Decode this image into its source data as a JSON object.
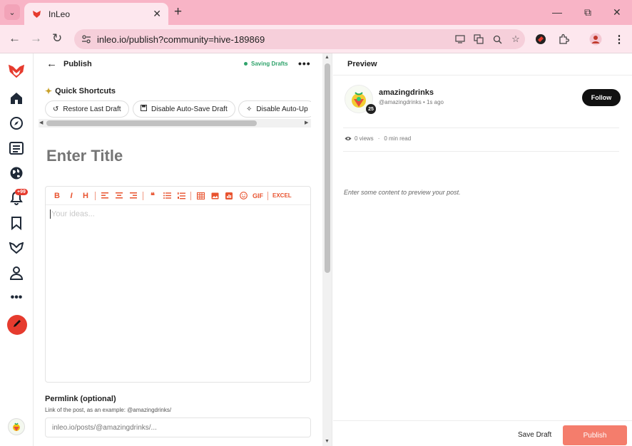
{
  "browser": {
    "tab_title": "InLeo",
    "url": "inleo.io/publish?community=hive-189869"
  },
  "editor": {
    "header_title": "Publish",
    "saving_status": "Saving Drafts",
    "quick_shortcuts_title": "Quick Shortcuts",
    "shortcuts": [
      {
        "label": "Restore Last Draft",
        "icon": "restore-icon"
      },
      {
        "label": "Disable Auto-Save Draft",
        "icon": "save-icon"
      },
      {
        "label": "Disable Auto-Up",
        "icon": "magic-wand-icon"
      }
    ],
    "title_placeholder": "Enter Title",
    "md_toolbar": {
      "gif_label": "GIF",
      "excel_label": "EXCEL"
    },
    "body_placeholder": "Your ideas...",
    "permlink": {
      "label": "Permlink (optional)",
      "help": "Link of the post, as an example: @amazingdrinks/",
      "placeholder": "inleo.io/posts/@amazingdrinks/..."
    }
  },
  "sidebar": {
    "notification_badge": "+99"
  },
  "preview": {
    "title": "Preview",
    "author_name": "amazingdrinks",
    "author_handle": "@amazingdrinks",
    "time_ago": "1s ago",
    "reputation": "25",
    "follow_label": "Follow",
    "views": "0 views",
    "read_time": "0 min read",
    "empty_message": "Enter some content to preview your post.",
    "save_draft_label": "Save Draft",
    "publish_label": "Publish"
  },
  "colors": {
    "brand": "#e63b2e",
    "tab_bar": "#f8b4c6",
    "publish": "#f47d6c",
    "saving": "#2fa36b"
  }
}
